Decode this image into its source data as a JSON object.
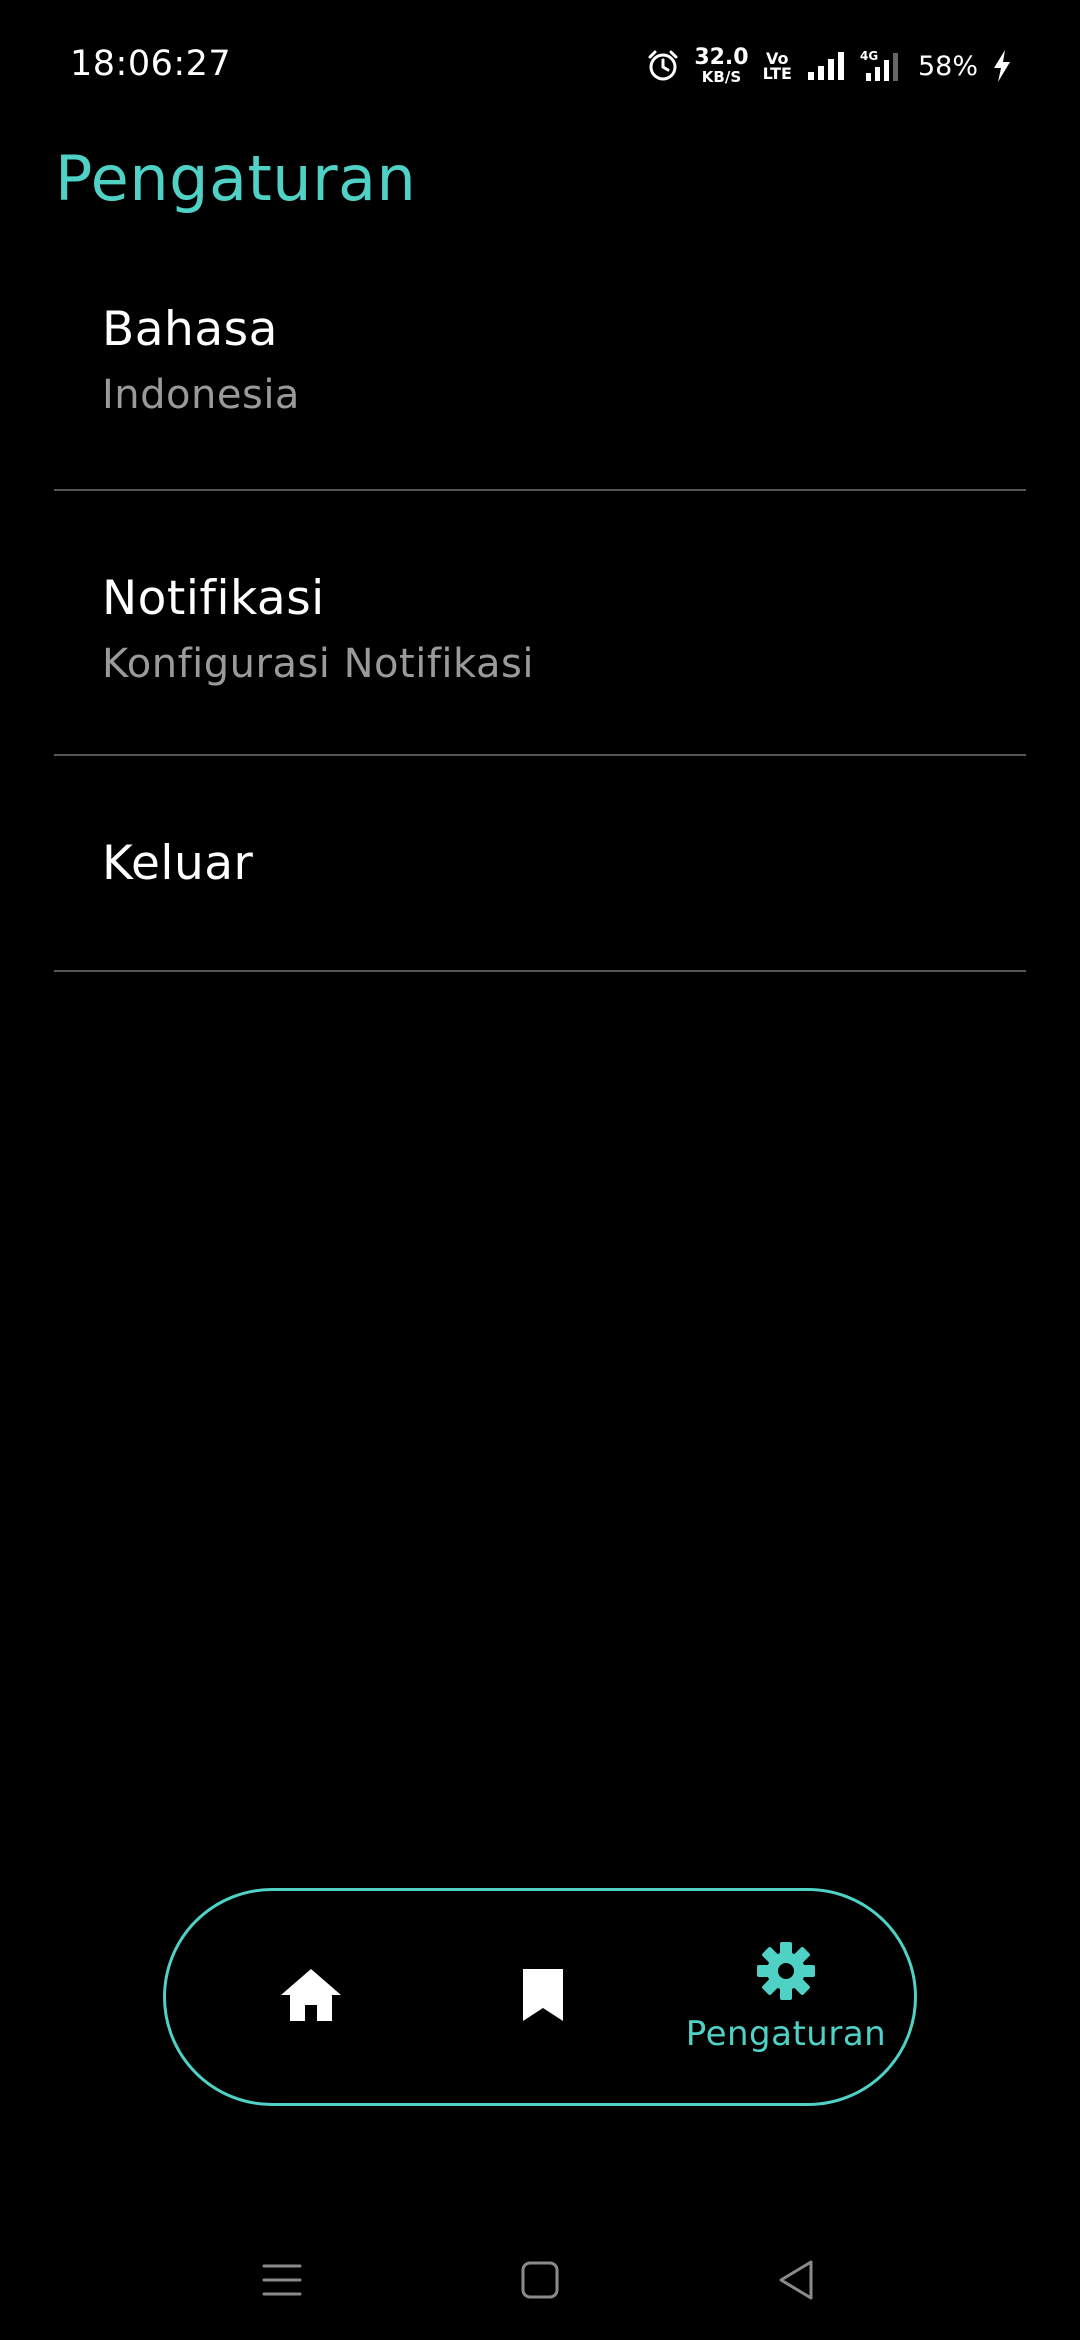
{
  "status_bar": {
    "time": "18:06:27",
    "net_speed_value": "32.0",
    "net_speed_unit": "KB/S",
    "volte_top": "Vo",
    "volte_bottom": "LTE",
    "network_type": "4G",
    "battery": "58%",
    "icons": [
      "alarm-icon",
      "signal-icon",
      "signal-4g-icon",
      "charging-icon"
    ]
  },
  "page": {
    "title": "Pengaturan"
  },
  "settings": [
    {
      "title": "Bahasa",
      "subtitle": "Indonesia"
    },
    {
      "title": "Notifikasi",
      "subtitle": "Konfigurasi Notifikasi"
    },
    {
      "title": "Keluar",
      "subtitle": ""
    }
  ],
  "bottom_nav": {
    "items": [
      {
        "icon": "home-icon",
        "label": "",
        "active": false
      },
      {
        "icon": "bookmark-icon",
        "label": "",
        "active": false
      },
      {
        "icon": "gear-icon",
        "label": "Pengaturan",
        "active": true
      }
    ]
  },
  "system_nav": {
    "icons": [
      "menu-icon",
      "home-square-icon",
      "back-icon"
    ]
  },
  "colors": {
    "accent": "#4fd1c5",
    "background": "#000000",
    "text_primary": "#ffffff",
    "text_secondary": "#9a9a9a",
    "divider": "#555555"
  }
}
